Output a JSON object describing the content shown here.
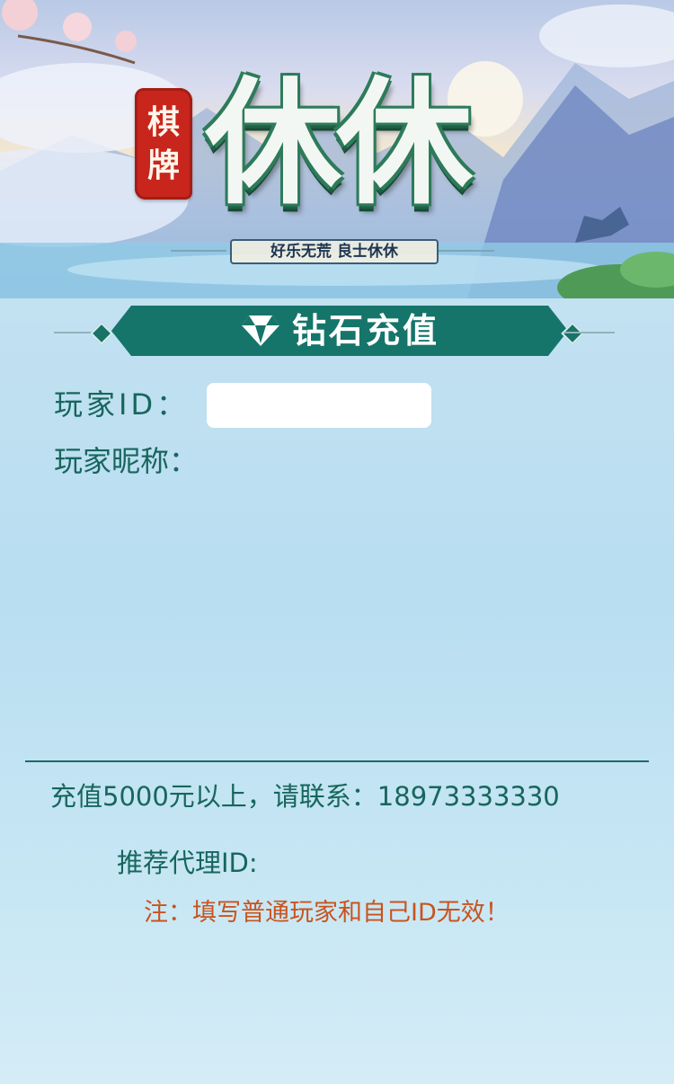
{
  "banner": {
    "seal_chars": [
      "棋",
      "牌"
    ],
    "logo_text": "休休",
    "slogan": "好乐无荒 良士休休"
  },
  "section": {
    "title": "钻石充值",
    "icon": "diamond-icon"
  },
  "form": {
    "player_id_label": "玩家ID：",
    "player_id_value": "",
    "player_nickname_label": "玩家昵称："
  },
  "footer": {
    "contact_text": "充值5000元以上，请联系：18973333330",
    "agent_id_label": "推荐代理ID:",
    "note": "注：填写普通玩家和自己ID无效！"
  },
  "colors": {
    "primary_green": "#16756a",
    "label_green": "#17665d",
    "note_orange": "#c8541e",
    "seal_red": "#c8261d"
  }
}
